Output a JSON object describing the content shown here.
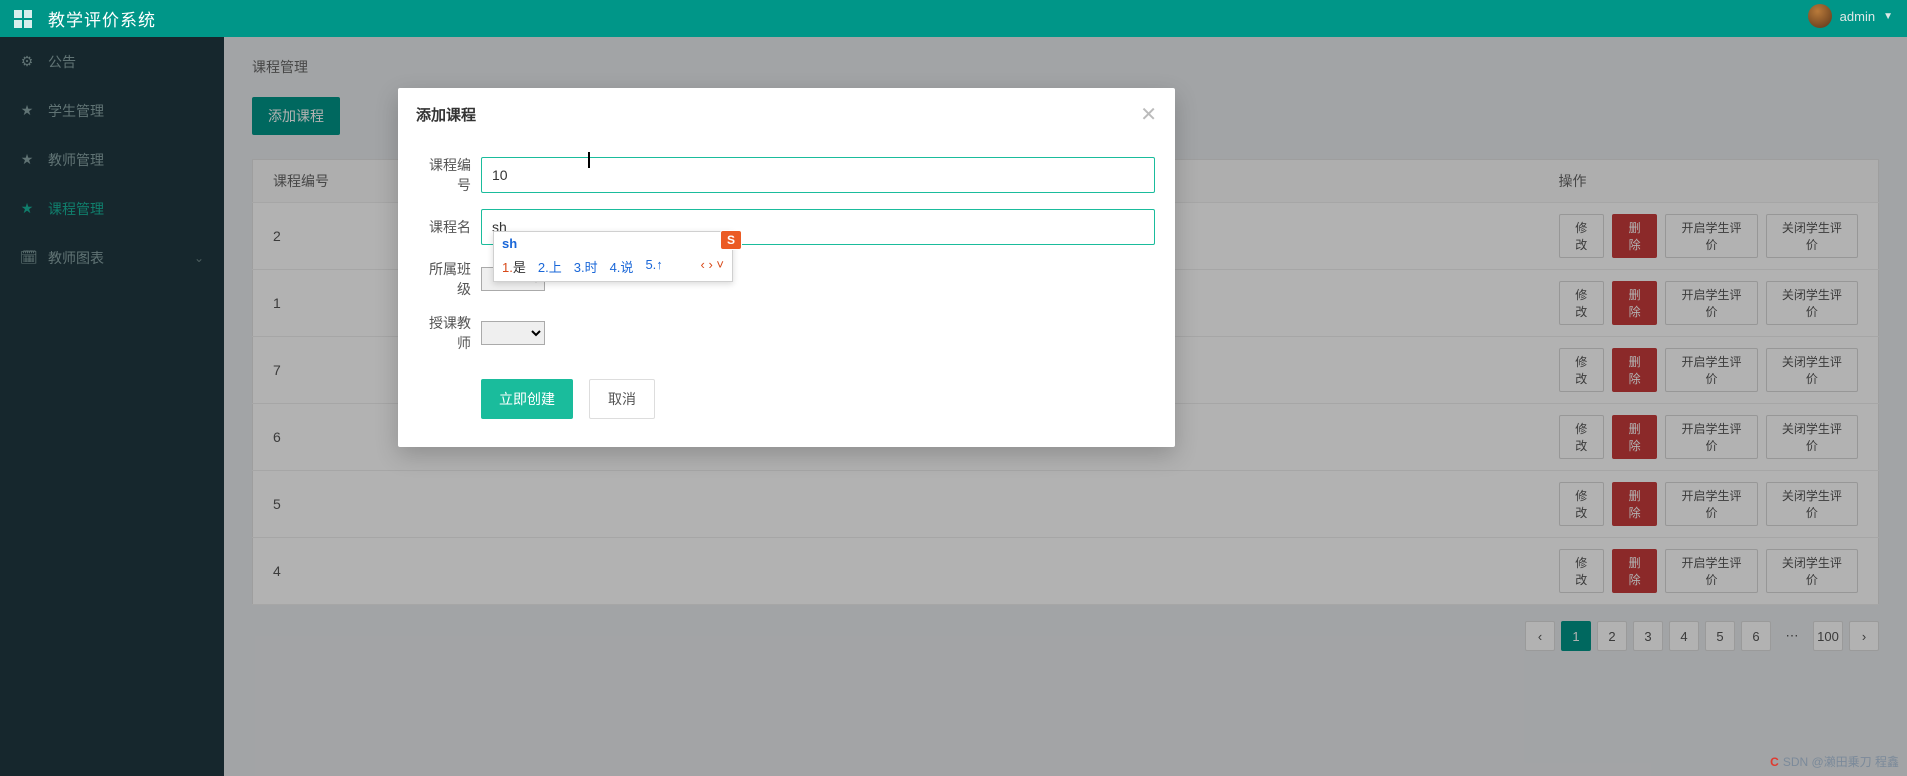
{
  "header": {
    "title": "教学评价系统",
    "user": "admin"
  },
  "sidebar": {
    "items": [
      {
        "icon": "⚙",
        "label": "公告"
      },
      {
        "icon": "★",
        "label": "学生管理"
      },
      {
        "icon": "★",
        "label": "教师管理"
      },
      {
        "icon": "★",
        "label": "课程管理",
        "active": true
      },
      {
        "icon": "🗓",
        "label": "教师图表",
        "expandable": true
      }
    ]
  },
  "page": {
    "crumb": "课程管理",
    "add_button": "添加课程",
    "columns": {
      "id": "课程编号",
      "ops": "操作"
    },
    "rows": [
      "2",
      "1",
      "7",
      "6",
      "5",
      "4"
    ],
    "ops": {
      "edit": "修改",
      "delete": "删除",
      "open": "开启学生评价",
      "close": "关闭学生评价"
    },
    "pager": {
      "pages": [
        "1",
        "2",
        "3",
        "4",
        "5",
        "6"
      ],
      "last": "100",
      "ell": "⋯",
      "prev": "‹",
      "next": "›"
    }
  },
  "modal": {
    "title": "添加课程",
    "fields": {
      "course_no": {
        "label": "课程编号",
        "value": "10"
      },
      "course_name": {
        "label": "课程名",
        "value": "sh"
      },
      "class": {
        "label": "所属班级"
      },
      "teacher": {
        "label": "授课教师"
      }
    },
    "buttons": {
      "create": "立即创建",
      "cancel": "取消"
    }
  },
  "ime": {
    "typed": "sh",
    "candidates": [
      {
        "n": "1.",
        "c": "是"
      },
      {
        "n": "2.",
        "c": "上"
      },
      {
        "n": "3.",
        "c": "时"
      },
      {
        "n": "4.",
        "c": "说"
      },
      {
        "n": "5.",
        "c": "↑"
      }
    ],
    "logo": "S"
  },
  "watermark": {
    "text": "SDN @濑田乗刀 程鑫"
  }
}
